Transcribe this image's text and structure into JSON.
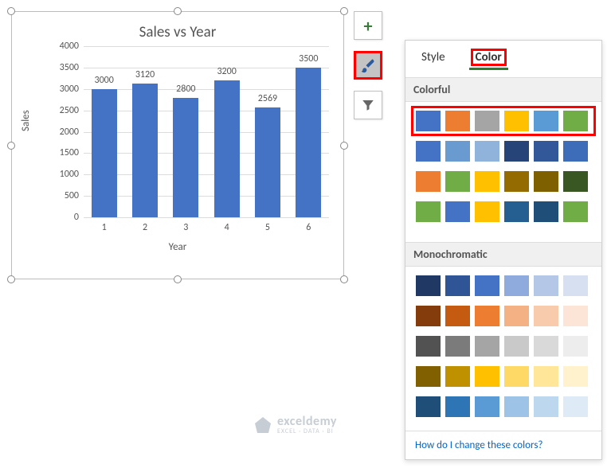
{
  "chart_data": {
    "type": "bar",
    "title": "Sales vs Year",
    "xlabel": "Year",
    "ylabel": "Sales",
    "ylim": [
      0,
      4000
    ],
    "ystep": 500,
    "categories": [
      "1",
      "2",
      "3",
      "4",
      "5",
      "6"
    ],
    "values": [
      3000,
      3120,
      2800,
      3200,
      2569,
      3500
    ],
    "yticks": [
      "0",
      "500",
      "1000",
      "1500",
      "2000",
      "2500",
      "3000",
      "3500",
      "4000"
    ]
  },
  "side_buttons": {
    "plus": "+",
    "brush": "brush-icon",
    "filter": "filter-icon"
  },
  "panel": {
    "tab_style": "Style",
    "tab_color": "Color",
    "section_colorful": "Colorful",
    "section_mono": "Monochromatic",
    "footer": "How do I change these colors?",
    "colorful_rows": [
      [
        "#4472c4",
        "#ed7d31",
        "#a5a5a5",
        "#ffc000",
        "#5b9bd5",
        "#70ad47"
      ],
      [
        "#4472c4",
        "#699bd0",
        "#8fb3db",
        "#264478",
        "#335899",
        "#3d6cb8"
      ],
      [
        "#ed7d31",
        "#70ad47",
        "#ffc000",
        "#946b00",
        "#7f6000",
        "#385723"
      ],
      [
        "#70ad47",
        "#4472c4",
        "#ffc000",
        "#255e91",
        "#1f4e79",
        "#70ad47"
      ]
    ],
    "mono_rows": [
      [
        "#1f3864",
        "#2f5597",
        "#4472c4",
        "#8faadc",
        "#b4c7e7",
        "#d6e0f0"
      ],
      [
        "#843c0c",
        "#c55a11",
        "#ed7d31",
        "#f4b183",
        "#f8cbad",
        "#fce4d6"
      ],
      [
        "#525252",
        "#7b7b7b",
        "#a5a5a5",
        "#c9c9c9",
        "#d9d9d9",
        "#ededed"
      ],
      [
        "#806000",
        "#bf9000",
        "#ffc000",
        "#ffd966",
        "#ffe699",
        "#fff2cc"
      ],
      [
        "#1f4e79",
        "#2e75b6",
        "#5b9bd5",
        "#9dc3e6",
        "#bdd7ee",
        "#deebf7"
      ]
    ]
  },
  "brand": {
    "name": "exceldemy",
    "tagline": "EXCEL · DATA · BI"
  }
}
